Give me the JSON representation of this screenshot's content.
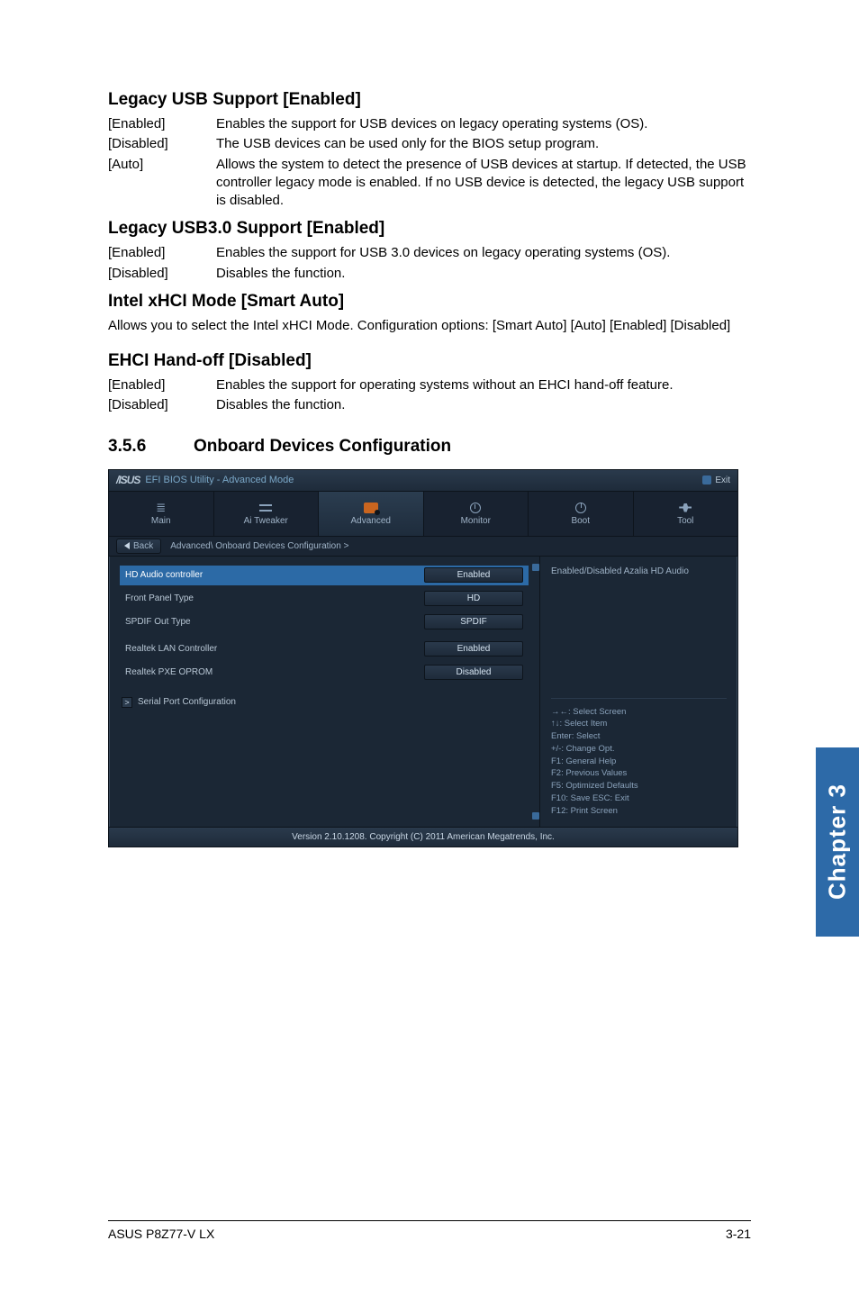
{
  "sections": {
    "legacy_usb": {
      "title": "Legacy USB Support [Enabled]",
      "rows": [
        {
          "term": "[Enabled]",
          "desc": "Enables the support for USB devices on legacy operating systems (OS)."
        },
        {
          "term": "[Disabled]",
          "desc": "The USB devices can be used only for the BIOS setup program."
        },
        {
          "term": "[Auto]",
          "desc": "Allows the system to detect the presence of USB devices at startup. If detected, the USB controller legacy mode is enabled. If no USB device is detected, the legacy USB support is disabled."
        }
      ]
    },
    "legacy_usb3": {
      "title": "Legacy USB3.0 Support [Enabled]",
      "rows": [
        {
          "term": "[Enabled]",
          "desc": "Enables the support for USB 3.0 devices on legacy operating systems (OS)."
        },
        {
          "term": "[Disabled]",
          "desc": "Disables the function."
        }
      ]
    },
    "xhci": {
      "title": "Intel xHCI Mode [Smart Auto]",
      "body": "Allows you to select the Intel xHCI Mode. Configuration options: [Smart Auto] [Auto] [Enabled] [Disabled]"
    },
    "ehci": {
      "title": "EHCI Hand-off [Disabled]",
      "rows": [
        {
          "term": "[Enabled]",
          "desc": "Enables the support for operating systems without an EHCI hand-off feature."
        },
        {
          "term": "[Disabled]",
          "desc": "Disables the function."
        }
      ]
    },
    "onboard": {
      "num": "3.5.6",
      "title": "Onboard Devices Configuration"
    }
  },
  "bios": {
    "logo": "/ISUS",
    "title": "EFI BIOS Utility - Advanced Mode",
    "exit": "Exit",
    "tabs": {
      "main": "Main",
      "tweaker": "Ai Tweaker",
      "advanced": "Advanced",
      "monitor": "Monitor",
      "boot": "Boot",
      "tool": "Tool"
    },
    "breadcrumb": {
      "back": "Back",
      "path": "Advanced\\ Onboard Devices Configuration >"
    },
    "rows": {
      "hd_audio": {
        "label": "HD Audio controller",
        "value": "Enabled"
      },
      "front_panel": {
        "label": "Front Panel Type",
        "value": "HD"
      },
      "spdif": {
        "label": "SPDIF Out Type",
        "value": "SPDIF"
      },
      "lan": {
        "label": "Realtek LAN Controller",
        "value": "Enabled"
      },
      "pxe": {
        "label": "Realtek PXE OPROM",
        "value": "Disabled"
      },
      "serial": {
        "label": "Serial Port Configuration"
      }
    },
    "help": {
      "top": "Enabled/Disabled Azalia HD Audio",
      "keys": {
        "l1": "→←: Select Screen",
        "l2": "↑↓: Select Item",
        "l3": "Enter: Select",
        "l4": "+/-: Change Opt.",
        "l5": "F1: General Help",
        "l6": "F2: Previous Values",
        "l7": "F5: Optimized Defaults",
        "l8": "F10: Save   ESC: Exit",
        "l9": "F12: Print Screen"
      }
    },
    "footer": "Version 2.10.1208. Copyright (C) 2011 American Megatrends, Inc."
  },
  "side_tab": "Chapter 3",
  "page_footer": {
    "left": "ASUS P8Z77-V LX",
    "right": "3-21"
  }
}
